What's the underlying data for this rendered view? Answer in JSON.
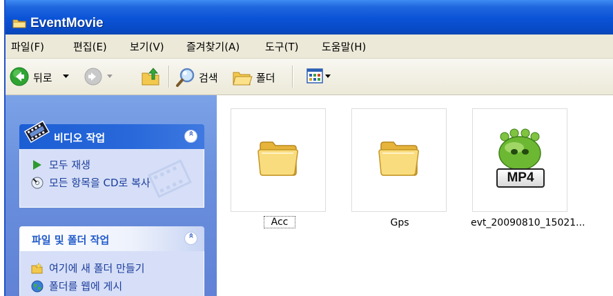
{
  "window": {
    "title": "EventMovie"
  },
  "menu": [
    "파일(F)",
    "편집(E)",
    "보기(V)",
    "즐겨찾기(A)",
    "도구(T)",
    "도움말(H)"
  ],
  "toolbar": {
    "back_label": "뒤로",
    "search_label": "검색",
    "folders_label": "폴더"
  },
  "taskpane": {
    "video_tasks": {
      "title": "비디오 작업",
      "collapse_glyph": "«",
      "items": [
        "모두 재생",
        "모든 항목을 CD로 복사"
      ]
    },
    "file_tasks": {
      "title": "파일 및 폴더 작업",
      "collapse_glyph": "«",
      "items": [
        "여기에 새 폴더 만들기",
        "폴더를 웹에 게시"
      ]
    }
  },
  "files": [
    {
      "name": "Acc",
      "type": "folder"
    },
    {
      "name": "Gps",
      "type": "folder"
    },
    {
      "name": "evt_20090810_15021...",
      "type": "mp4",
      "badge": "MP4"
    }
  ]
}
